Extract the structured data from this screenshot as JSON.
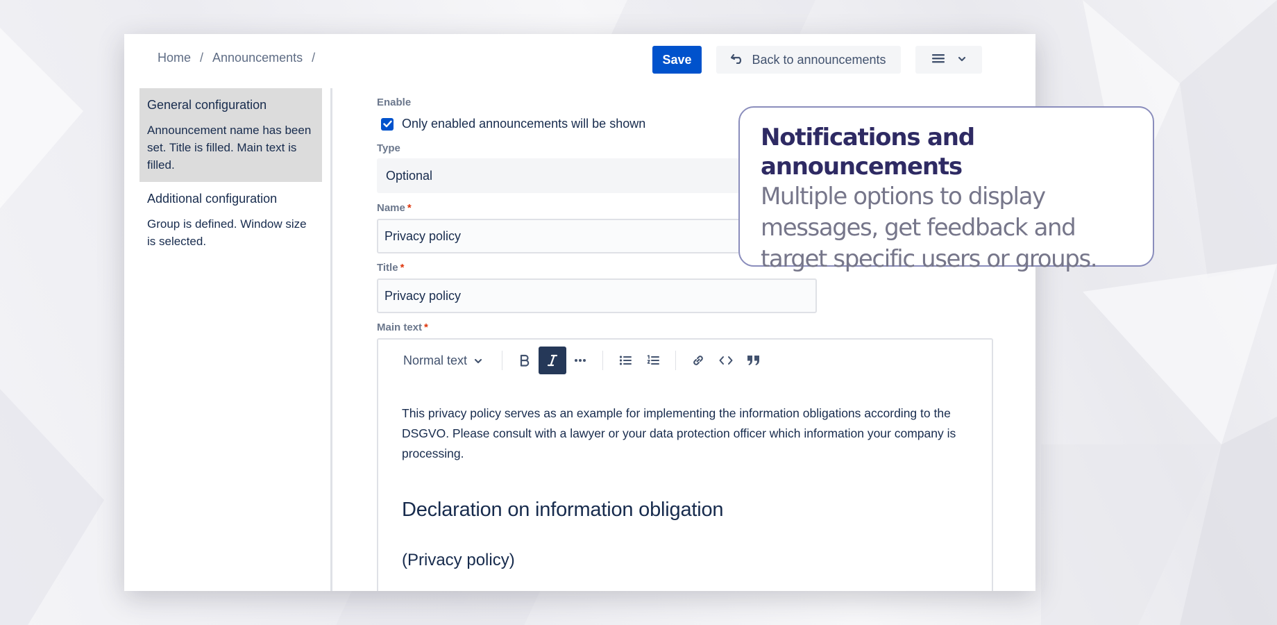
{
  "breadcrumb": {
    "items": [
      "Home",
      "Announcements"
    ],
    "separator": "/"
  },
  "header": {
    "save_label": "Save",
    "back_label": "Back to announcements",
    "back_icon": "undo-icon",
    "menu_icon": "hamburger-icon"
  },
  "nav": {
    "items": [
      {
        "title": "General configuration",
        "description": "Announcement name has been set. Title is filled. Main text is filled."
      },
      {
        "title": "Additional configuration",
        "description": "Group is defined. Window size is selected."
      }
    ]
  },
  "form": {
    "enable": {
      "label": "Enable",
      "checkbox_label": "Only enabled announcements will be shown",
      "checked": true
    },
    "type": {
      "label": "Type",
      "value": "Optional"
    },
    "name": {
      "label": "Name",
      "value": "Privacy policy",
      "required_mark": "*"
    },
    "title": {
      "label": "Title",
      "value": "Privacy policy",
      "required_mark": "*"
    },
    "main_text": {
      "label": "Main text",
      "required_mark": "*",
      "toolbar": {
        "style_label": "Normal text",
        "buttons": [
          "bold-icon",
          "italic-icon",
          "more-icon",
          "bullet-list-icon",
          "numbered-list-icon",
          "link-icon",
          "code-icon",
          "quote-icon"
        ],
        "active": "italic-icon"
      },
      "content": {
        "paragraph": "This privacy policy serves as an example for implementing the information obligations according to the DSGVO. Please consult with a lawyer or your data protection officer which information your company is processing.",
        "heading": "Declaration on information obligation",
        "subheading": "(Privacy policy)"
      }
    }
  },
  "callout": {
    "title": "Notifications and announcements",
    "body": "Multiple options to display messages, get feedback and target specific users or groups."
  },
  "colors": {
    "primary": "#0052cc",
    "text": "#172b4d",
    "muted": "#6b778c",
    "required": "#de350b",
    "callout_title": "#2e2a63",
    "callout_border": "#8a8dbc"
  }
}
